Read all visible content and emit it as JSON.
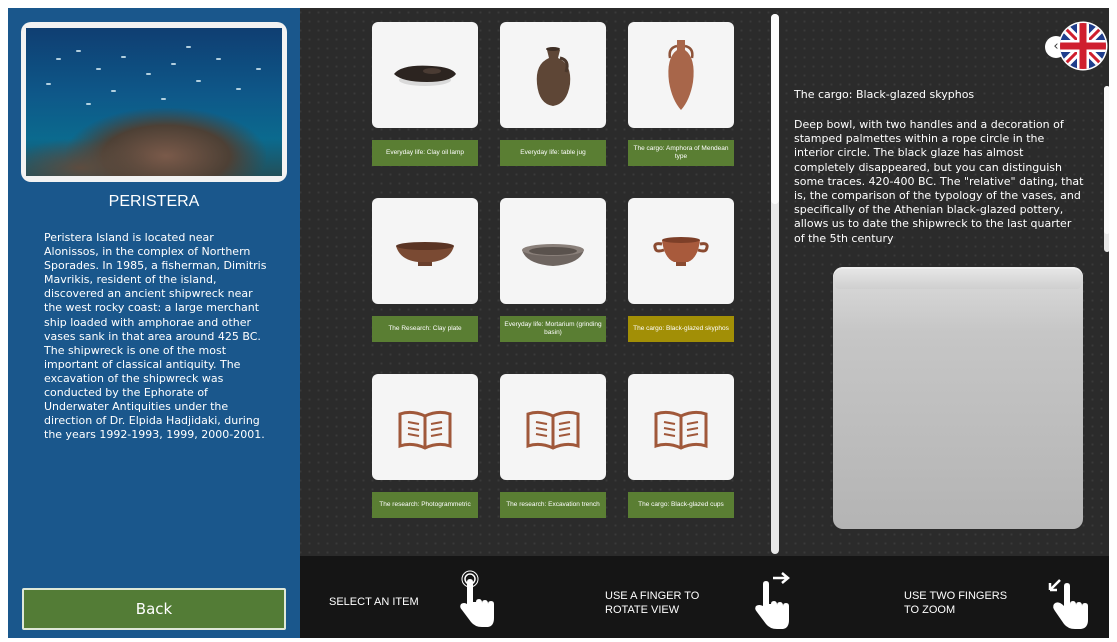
{
  "site": {
    "title": "PERISTERA",
    "description": "Peristera Island is located near Alonissos, in the complex of Northern Sporades. In 1985, a fisherman, Dimitris Mavrikis, resident of the island, discovered an ancient shipwreck near the west rocky coast: a large merchant ship loaded with amphorae and other vases sank in that area around 425 BC. The shipwreck is one of the most important of classical antiquity. The excavation of the shipwreck was conducted by the Ephorate of Underwater Antiquities under the direction of Dr. Elpida Hadjidaki, during the years 1992-1993, 1999, 2000-2001.",
    "back_label": "Back"
  },
  "items": [
    {
      "label": "Everyday life: Clay oil lamp",
      "icon": "clay-oil-lamp",
      "selected": false
    },
    {
      "label": "Everyday life: table jug",
      "icon": "table-jug",
      "selected": false
    },
    {
      "label": "The cargo: Amphora of Mendean type",
      "icon": "amphora",
      "selected": false
    },
    {
      "label": "The Research: Clay plate",
      "icon": "clay-plate",
      "selected": false
    },
    {
      "label": "Everyday life: Mortarium (grinding basin)",
      "icon": "mortarium",
      "selected": false
    },
    {
      "label": "The cargo: Black-glazed skyphos",
      "icon": "skyphos",
      "selected": true
    },
    {
      "label": "The research: Photogrammetric",
      "icon": "book-icon",
      "selected": false
    },
    {
      "label": "The research: Excavation trench",
      "icon": "book-icon",
      "selected": false
    },
    {
      "label": "The cargo: Black-glazed cups",
      "icon": "book-icon",
      "selected": false
    }
  ],
  "detail": {
    "title": "The cargo: Black-glazed skyphos",
    "text": "Deep bowl, with two handles and a decoration of stamped palmettes within a rope circle in the interior circle. The black glaze has almost completely disappeared, but you can distinguish some traces. 420-400 BC. The \"relative\" dating, that is, the comparison of the typology of the vases, and specifically of the Athenian black-glazed pottery, allows us to date the shipwreck to the last quarter of the 5th century"
  },
  "instructions": [
    {
      "line1": "SELECT AN ITEM",
      "line2": "",
      "icon": "tap-hand-icon"
    },
    {
      "line1": "USE A FINGER TO",
      "line2": "ROTATE VIEW",
      "icon": "swipe-hand-icon"
    },
    {
      "line1": "USE TWO FINGERS",
      "line2": "TO ZOOM",
      "icon": "pinch-hand-icon"
    }
  ],
  "language": {
    "icon": "uk-flag-icon",
    "collapse_icon": "chevron-left-icon"
  },
  "colors": {
    "panel_blue": "#1a578c",
    "label_green": "#5a7e33",
    "label_selected": "#a28f06",
    "back_green": "#537c36",
    "background": "#2b2b2b",
    "instruction_bar": "#151515"
  }
}
